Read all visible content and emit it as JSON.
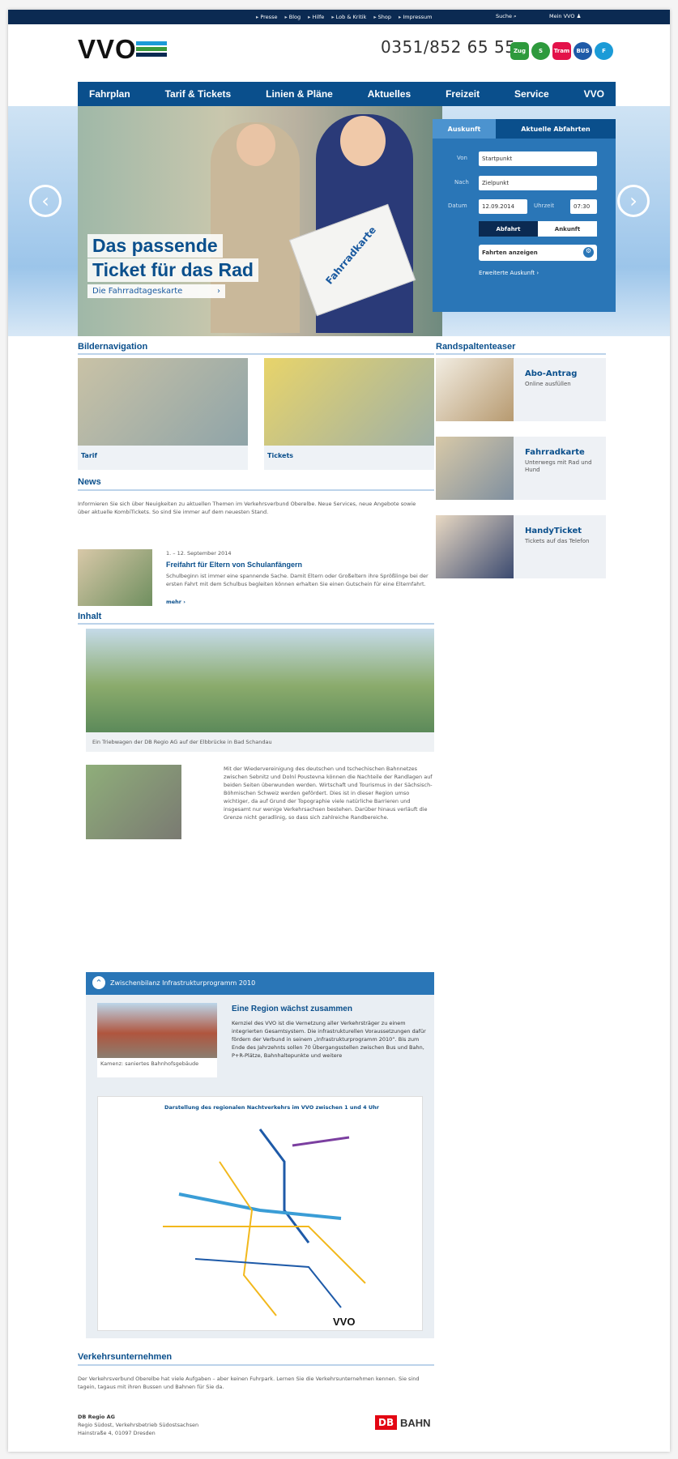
{
  "topbar": {
    "links": [
      "Presse",
      "Blog",
      "Hilfe",
      "Lob & Kritik",
      "Shop",
      "Impressum"
    ],
    "search": "Suche",
    "mein": "Mein VVO"
  },
  "brand": {
    "logo": "VVO",
    "phone": "0351/852 65 55",
    "modes": [
      "Zug",
      "S",
      "Tram",
      "BUS",
      "F"
    ]
  },
  "nav": [
    "Fahrplan",
    "Tarif & Tickets",
    "Linien & Pläne",
    "Aktuelles",
    "Freizeit",
    "Service",
    "VVO"
  ],
  "hero": {
    "line1": "Das passende",
    "line2": "Ticket für das Rad",
    "sub": "Die Fahrradtageskarte",
    "card": "Fahrradkarte"
  },
  "box": {
    "tab1": "Auskunft",
    "tab2": "Aktuelle Abfahrten",
    "von": "Von",
    "nach": "Nach",
    "start": "Startpunkt",
    "ziel": "Zielpunkt",
    "datum": "Datum",
    "date": "12.09.2014",
    "uhrzeit": "Uhrzeit",
    "time": "07:30",
    "abfahrt": "Abfahrt",
    "ankunft": "Ankunft",
    "show": "Fahrten anzeigen",
    "extended": "Erweiterte Auskunft"
  },
  "sections": {
    "bild": "Bildernavigation",
    "rand": "Randspaltenteaser",
    "news": "News",
    "inhalt": "Inhalt",
    "verkehr": "Verkehrsunternehmen"
  },
  "tiles": [
    "Tarif",
    "Tickets"
  ],
  "teasers": [
    {
      "t": "Abo-Antrag",
      "s": "Online ausfüllen"
    },
    {
      "t": "Fahrradkarte",
      "s": "Unterwegs mit Rad und Hund"
    },
    {
      "t": "HandyTicket",
      "s": "Tickets auf das Telefon"
    }
  ],
  "news": {
    "intro": "Informieren Sie sich über Neuigkeiten zu aktuellen Themen im Verkehrsverbund Oberelbe. Neue Services, neue Angebote sowie über aktuelle KombiTickets. So sind Sie immer auf dem neuesten Stand.",
    "date": "1. – 12. September 2014",
    "title": "Freifahrt für Eltern von Schulanfängern",
    "text": "Schulbeginn ist immer eine spannende Sache. Damit Eltern oder Großeltern ihre Sprößlinge bei der ersten Fahrt mit dem Schulbus begleiten können erhalten Sie einen Gutschein für eine Elternfahrt.",
    "more": "mehr"
  },
  "inhalt": {
    "caption": "Ein Triebwagen der DB Regio AG auf der Elbbrücke in Bad Schandau",
    "text": "Mit der Wiedervereinigung des deutschen und tschechischen Bahnnetzes zwischen Sebnitz und Dolní Poustevna können die Nachteile der Randlagen auf beiden Seiten überwunden werden. Wirtschaft und Tourismus in der Sächsisch-Böhmischen Schweiz werden gefördert. Dies ist in dieser Region umso wichtiger, da auf Grund der Topographie viele natürliche Barrieren und insgesamt nur wenige Verkehrsachsen bestehen. Darüber hinaus verläuft die Grenze nicht geradlinig, so dass sich zahlreiche Randbereiche."
  },
  "info": {
    "bar": "Zwischenbilanz Infrastrukturprogramm 2010",
    "caption": "Kamenz: saniertes Bahnhofsgebäude",
    "title": "Eine Region wächst zusammen",
    "text": "Kernziel des VVO ist die Vernetzung aller Verkehrsträger zu einem integrierten Gesamtsystem. Die infrastrukturellen Voraussetzungen dafür fördern der Verbund in seinem „Infrastrukturprogramm 2010“. Bis zum Ende des Jahrzehnts sollen 70 Übergangsstellen zwischen Bus und Bahn, P+R-Plätze, Bahnhaltepunkte und weitere",
    "maptitle": "Darstellung des regionalen Nachtverkehrs im VVO zwischen 1 und 4 Uhr",
    "maplogo": "VVO"
  },
  "verkehr": {
    "text": "Der Verkehrsverbund Oberelbe hat viele Aufgaben – aber keinen Fuhrpark. Lernen Sie die Verkehrsunternehmen kennen. Sie sind tagein, tagaus mit ihren Bussen und Bahnen für Sie da.",
    "name": "DB Regio AG",
    "l1": "Regio Südost, Verkehrsbetrieb Südostsachsen",
    "l2": "Hainstraße 4, 01097 Dresden",
    "db": "DB",
    "bahn": "BAHN"
  },
  "colors": {
    "brand": "#0a4f8c",
    "accent": "#2a76b7",
    "top": "#0b2a52"
  }
}
